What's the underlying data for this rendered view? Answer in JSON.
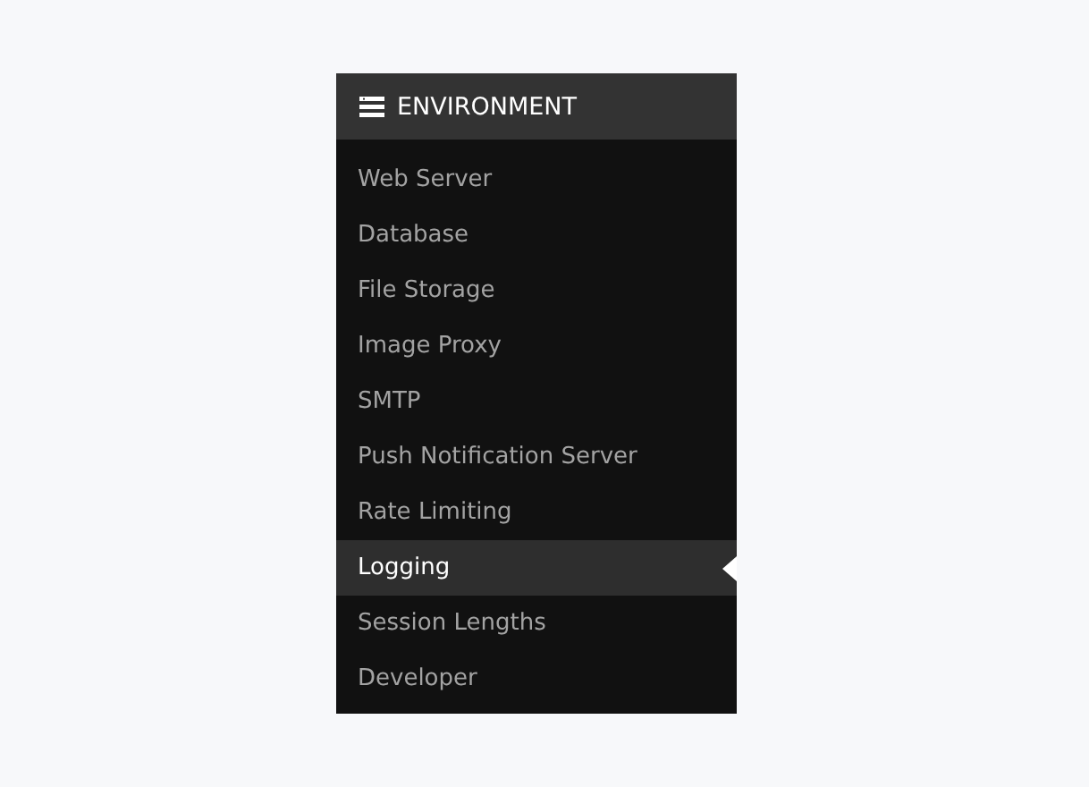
{
  "section": {
    "title": "ENVIRONMENT"
  },
  "items": [
    {
      "label": "Web Server",
      "selected": false
    },
    {
      "label": "Database",
      "selected": false
    },
    {
      "label": "File Storage",
      "selected": false
    },
    {
      "label": "Image Proxy",
      "selected": false
    },
    {
      "label": "SMTP",
      "selected": false
    },
    {
      "label": "Push Notification Server",
      "selected": false
    },
    {
      "label": "Rate Limiting",
      "selected": false
    },
    {
      "label": "Logging",
      "selected": true
    },
    {
      "label": "Session Lengths",
      "selected": false
    },
    {
      "label": "Developer",
      "selected": false
    }
  ]
}
